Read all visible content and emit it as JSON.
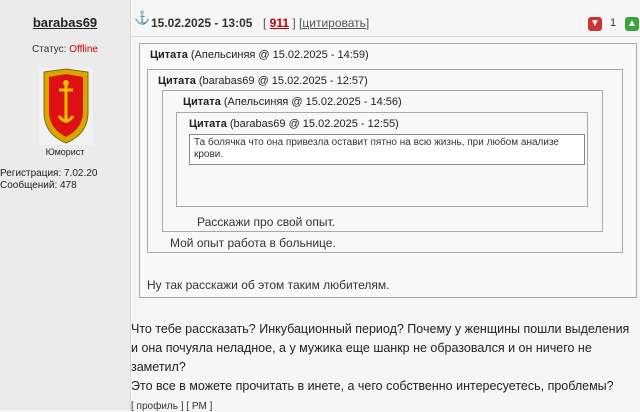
{
  "user": {
    "name": "barabas69",
    "status_label": "Статус:",
    "status_value": "Offline",
    "rank": "Юморист",
    "registration": "Регистрация: 7.02.20",
    "messages": "Сообщений: 478"
  },
  "post": {
    "anchor_icon": "anchor-icon",
    "datetime": "15.02.2025 - 13:05",
    "number": "911",
    "quote_label": "цитировать",
    "vote_count": "1"
  },
  "quotes": [
    {
      "label": "Цитата",
      "meta": "(Апельсиняя @ 15.02.2025 - 14:59)",
      "reply": "Ну так расскажи об этом таким любителям."
    },
    {
      "label": "Цитата",
      "meta": "(barabas69 @ 15.02.2025 - 12:57)",
      "reply": "Мой опыт работа в больнице."
    },
    {
      "label": "Цитата",
      "meta": "(Апельсиняя @ 15.02.2025 - 14:56)",
      "reply": "Расскажи про свой опыт."
    },
    {
      "label": "Цитата",
      "meta": "(barabas69 @ 15.02.2025 - 12:55)",
      "reply": "Та болячка что она привезла оставит пятно на всю жизнь, при любом анализе крови."
    }
  ],
  "body": {
    "line1": "Что тебе рассказать? Инкубационный период? Почему у женщины пошли выделения",
    "line2": "и она почуяла неладное, а у мужика еще шанкр не образовался и он ничего не",
    "line3": "заметил?",
    "line4": "Это все в можете прочитать в инете, а чего собственно интересуетесь, проблемы?"
  },
  "footer": {
    "links": "[ профиль ] [ PM ]"
  },
  "colors": {
    "offline": "#cc0000",
    "post_number": "#c40000"
  }
}
